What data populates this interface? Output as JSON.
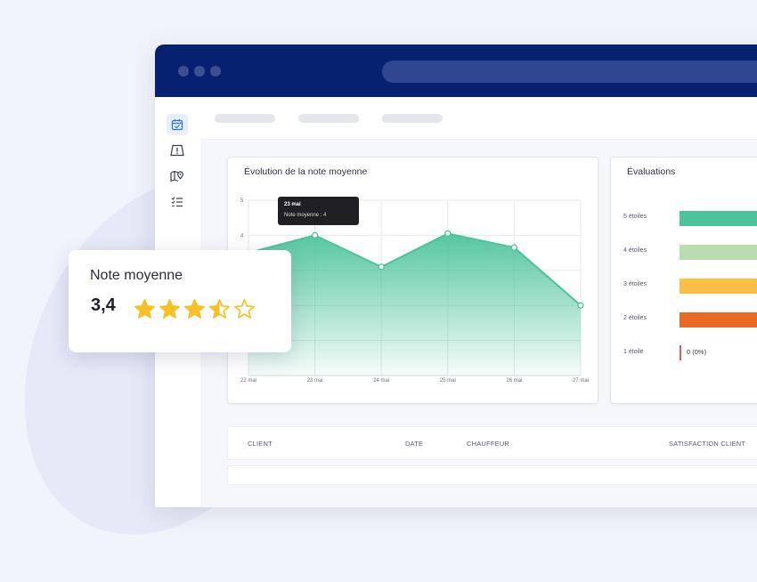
{
  "chart_card": {
    "title": "Évolution de la note moyenne"
  },
  "tooltip": {
    "date": "23 mai",
    "text": "Note moyenne : 4"
  },
  "chart_data": {
    "type": "area",
    "title": "Évolution de la note moyenne",
    "categories": [
      "22 mai",
      "23 mai",
      "24 mai",
      "25 mai",
      "26 mai",
      "27 mai"
    ],
    "y_ticks": [
      "5",
      "4"
    ],
    "ylim": [
      0,
      5
    ],
    "series": [
      {
        "values": [
          3.5,
          4.0,
          3.1,
          4.05,
          3.65,
          2.0
        ]
      }
    ],
    "grid": true,
    "color": "#4cc39b"
  },
  "evaluations": {
    "title": "Évaluations",
    "rows": [
      {
        "label": "5 étoiles",
        "color": "#4cc39b"
      },
      {
        "label": "4 étoiles",
        "color": "#b9ddb0"
      },
      {
        "label": "3 étoiles",
        "color": "#fbbf45"
      },
      {
        "label": "2 étoiles",
        "color": "#ea6a25"
      },
      {
        "label": "1 étoile",
        "color": "#e05b5b",
        "value_text": "0 (0%)"
      }
    ]
  },
  "table": {
    "columns": [
      "CLIENT",
      "DATE",
      "CHAUFFEUR",
      "SATISFACTION CLIENT"
    ]
  },
  "note_card": {
    "title": "Note moyenne",
    "value": "3,4",
    "rating": 3.4,
    "max": 5,
    "star_color": "#f6c026"
  },
  "sidebar": {
    "icons": [
      "calendar-check-icon",
      "road-warning-icon",
      "map-pin-icon",
      "checklist-icon"
    ]
  }
}
